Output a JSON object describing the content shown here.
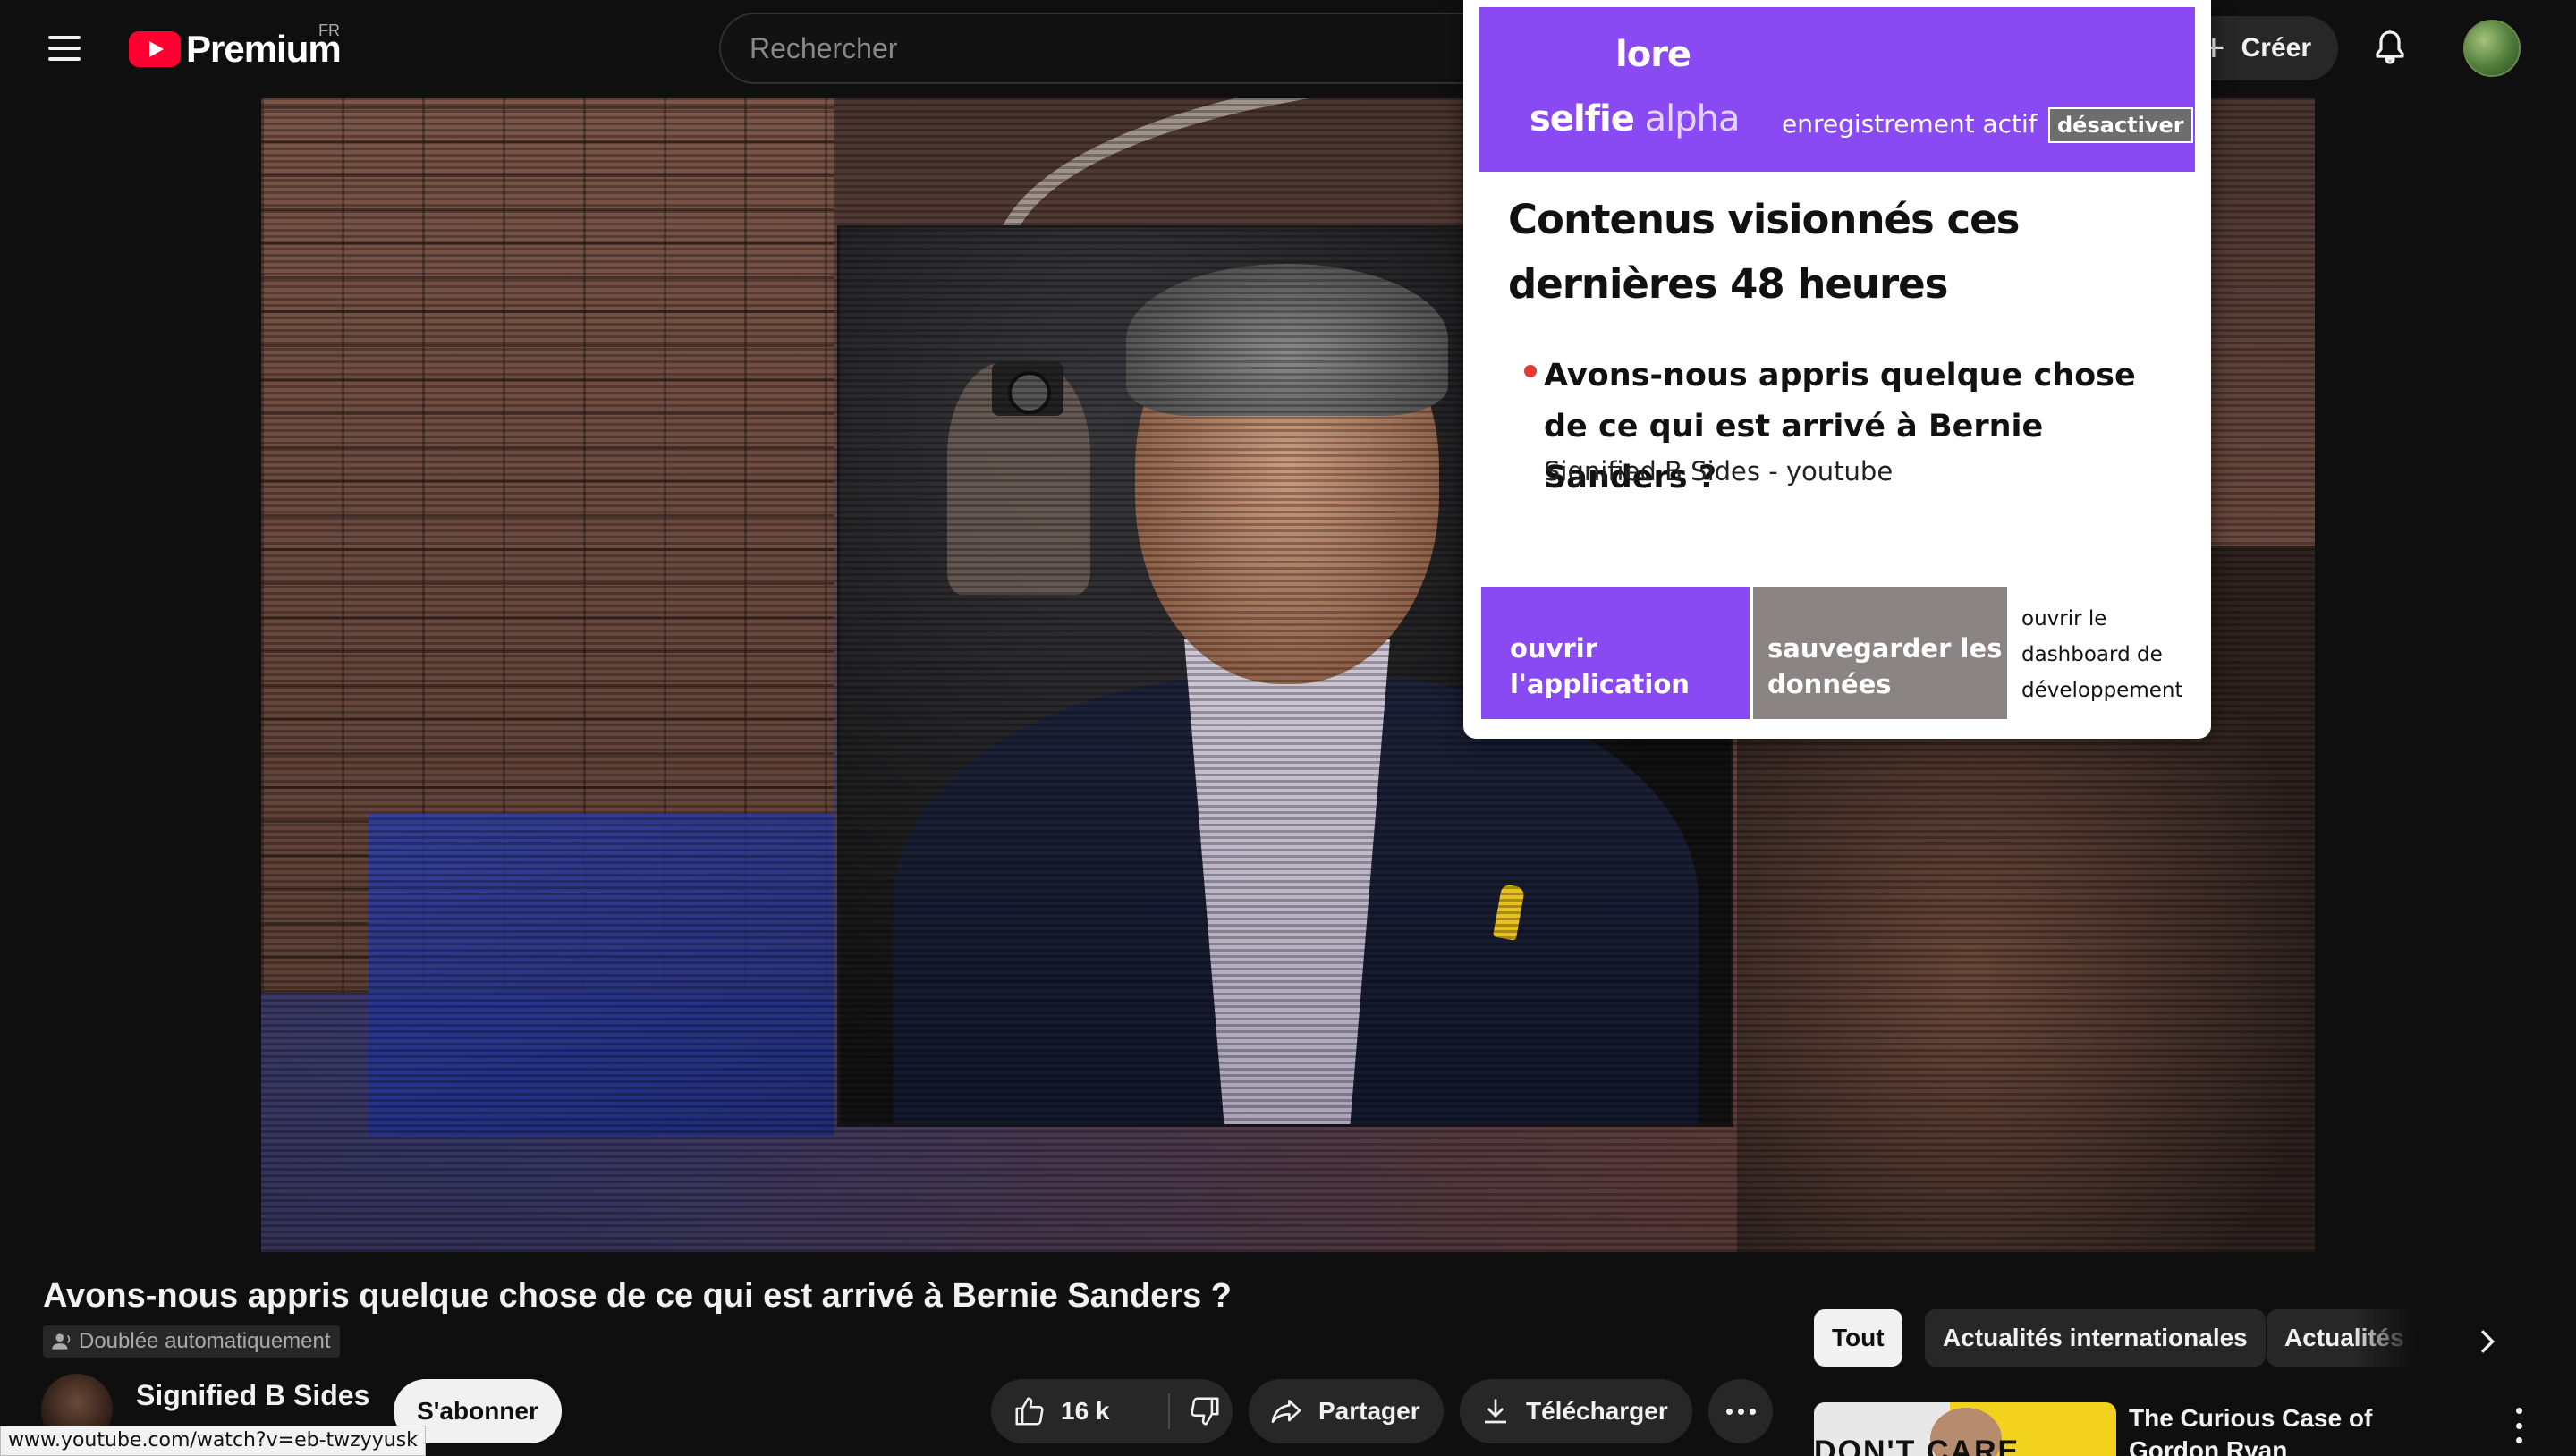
{
  "header": {
    "brand": "Premium",
    "country": "FR",
    "search_placeholder": "Rechercher",
    "create_label": "Créer"
  },
  "overlay": {
    "app_name": "lore",
    "brand_bold": "selfie",
    "brand_light": "alpha",
    "recording_status": "enregistrement actif",
    "deactivate_label": "désactiver",
    "heading": "Contenus visionnés ces dernières 48 heures",
    "item": {
      "title": "Avons-nous appris quelque chose de ce qui est arrivé à Bernie Sanders ?",
      "source": "Signified B Sides - youtube"
    },
    "open_app_label": "ouvrir l'application",
    "save_data_label": "sauvegarder les données",
    "dev_dashboard_label": "ouvrir le dashboard de développement"
  },
  "video": {
    "title": "Avons-nous appris quelque chose de ce qui est arrivé à Bernie Sanders ?",
    "dub_badge": "Doublée automatiquement",
    "channel_name": "Signified B Sides",
    "subscribe_label": "S'abonner",
    "likes": "16 k",
    "share_label": "Partager",
    "download_label": "Télécharger"
  },
  "chips": [
    "Tout",
    "Actualités internationales",
    "Actualités po"
  ],
  "recommendation": {
    "title": "The Curious Case of Gordon Ryan",
    "thumb_text": "DON'T    CARE"
  },
  "status_bar": {
    "url": "www.youtube.com/watch?v=eb-twzyyusk"
  },
  "colors": {
    "background": "#0f0f0f",
    "youtube_red": "#ff0033",
    "lore_purple": "#8a4af3",
    "lore_gray": "#8a8484"
  },
  "icons": [
    "menu-icon",
    "youtube-logo-icon",
    "plus-icon",
    "bell-icon",
    "dub-icon",
    "like-icon",
    "dislike-icon",
    "share-icon",
    "download-icon",
    "more-icon",
    "chevron-right-icon"
  ]
}
